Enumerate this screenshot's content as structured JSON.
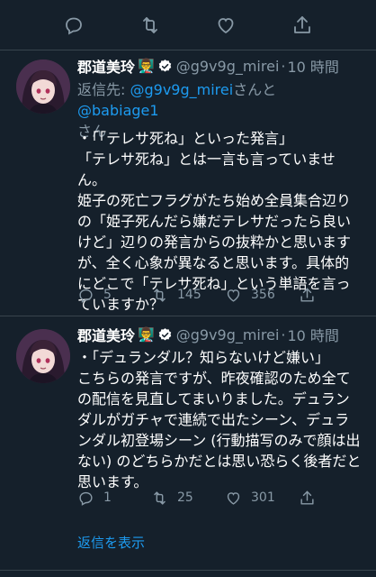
{
  "top_actions": {
    "icons": [
      "reply-icon",
      "retweet-icon",
      "like-icon",
      "share-icon"
    ]
  },
  "tweets": [
    {
      "author": {
        "name": "郡道美玲",
        "emoji": "👨‍🏫",
        "handle": "@g9v9g_mirei",
        "separator": "·",
        "time": "10 時間"
      },
      "reply_to": {
        "prefix": "返信先: ",
        "mention1": "@g9v9g_mirei",
        "joiner": "さんと",
        "mention2": "@babiage1",
        "suffix": "さん"
      },
      "text": "・「「テレサ死ね」といった発言」\n「テレサ死ね」とは一言も言っていません。\n姫子の死亡フラグがたち始め全員集合辺りの「姫子死んだら嫌だテレサだったら良いけど」辺りの発言からの抜粋かと思いますが、全く心象が異なると思います。具体的にどこで「テレサ死ね」という単語を言っていますか？",
      "stats": {
        "replies": "5",
        "retweets": "145",
        "likes": "356"
      }
    },
    {
      "author": {
        "name": "郡道美玲",
        "emoji": "👨‍🏫",
        "handle": "@g9v9g_mirei",
        "separator": "·",
        "time": "10 時間"
      },
      "text": "・「デュランダル？知らないけど嫌い」\nこちらの発言ですが、昨夜確認のため全ての配信を見直してまいりました。デュランダルがガチャで連続で出たシーン、デュランダル初登場シーン (行動描写のみで顔は出ない) のどちらかだとは思い恐らく後者だと思います。",
      "stats": {
        "replies": "1",
        "retweets": "25",
        "likes": "301"
      }
    }
  ],
  "show_replies_label": "返信を表示",
  "colors": {
    "background": "#15202b",
    "secondary_text": "#8899a6",
    "link": "#1d9bf0"
  }
}
